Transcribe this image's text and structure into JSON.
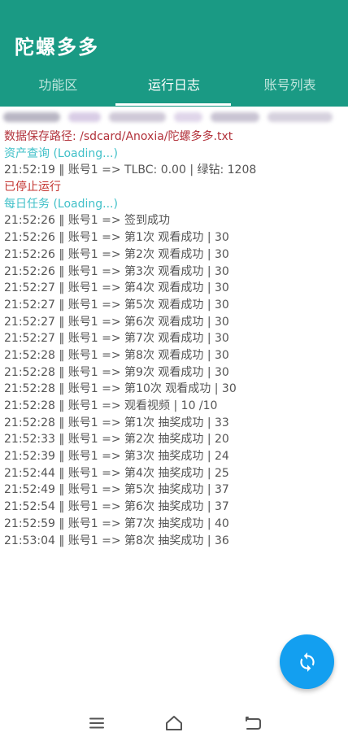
{
  "app": {
    "title": "陀螺多多",
    "colors": {
      "primary": "#1a9a84",
      "fab": "#139ff0",
      "path_text": "#b2323b",
      "section_text": "#41c0c8",
      "status_text": "#c3332f",
      "log_text": "#555555"
    }
  },
  "tabs": [
    {
      "label": "功能区",
      "active": false
    },
    {
      "label": "运行日志",
      "active": true
    },
    {
      "label": "账号列表",
      "active": false
    }
  ],
  "log": {
    "lines": [
      {
        "type": "path",
        "text": "数据保存路径: /sdcard/Anoxia/陀螺多多.txt"
      },
      {
        "type": "section",
        "text": "资产查询 (Loading...)"
      },
      {
        "type": "entry",
        "text": "21:52:19 ‖ 账号1 => TLBC: 0.00 | 绿钻: 1208"
      },
      {
        "type": "status",
        "text": "已停止运行"
      },
      {
        "type": "section",
        "text": "每日任务 (Loading...)"
      },
      {
        "type": "entry",
        "text": "21:52:26 ‖ 账号1 => 签到成功"
      },
      {
        "type": "entry",
        "text": "21:52:26 ‖ 账号1 => 第1次 观看成功 | 30"
      },
      {
        "type": "entry",
        "text": "21:52:26 ‖ 账号1 => 第2次 观看成功 | 30"
      },
      {
        "type": "entry",
        "text": "21:52:26 ‖ 账号1 => 第3次 观看成功 | 30"
      },
      {
        "type": "entry",
        "text": "21:52:27 ‖ 账号1 => 第4次 观看成功 | 30"
      },
      {
        "type": "entry",
        "text": "21:52:27 ‖ 账号1 => 第5次 观看成功 | 30"
      },
      {
        "type": "entry",
        "text": "21:52:27 ‖ 账号1 => 第6次 观看成功 | 30"
      },
      {
        "type": "entry",
        "text": "21:52:27 ‖ 账号1 => 第7次 观看成功 | 30"
      },
      {
        "type": "entry",
        "text": "21:52:28 ‖ 账号1 => 第8次 观看成功 | 30"
      },
      {
        "type": "entry",
        "text": "21:52:28 ‖ 账号1 => 第9次 观看成功 | 30"
      },
      {
        "type": "entry",
        "text": "21:52:28 ‖ 账号1 => 第10次 观看成功 | 30"
      },
      {
        "type": "entry",
        "text": "21:52:28 ‖ 账号1 => 观看视频 | 10 /10"
      },
      {
        "type": "entry",
        "text": "21:52:28 ‖ 账号1 => 第1次 抽奖成功 | 33"
      },
      {
        "type": "entry",
        "text": "21:52:33 ‖ 账号1 => 第2次 抽奖成功 | 20"
      },
      {
        "type": "entry",
        "text": "21:52:39 ‖ 账号1 => 第3次 抽奖成功 | 24"
      },
      {
        "type": "entry",
        "text": "21:52:44 ‖ 账号1 => 第4次 抽奖成功 | 25"
      },
      {
        "type": "entry",
        "text": "21:52:49 ‖ 账号1 => 第5次 抽奖成功 | 37"
      },
      {
        "type": "entry",
        "text": "21:52:54 ‖ 账号1 => 第6次 抽奖成功 | 37"
      },
      {
        "type": "entry",
        "text": "21:52:59 ‖ 账号1 => 第7次 抽奖成功 | 40"
      },
      {
        "type": "entry",
        "text": "21:53:04 ‖ 账号1 => 第8次 抽奖成功 | 36"
      }
    ]
  },
  "fab": {
    "icon": "sync-icon"
  },
  "nav": {
    "menu_icon": "menu-icon",
    "home_icon": "home-icon",
    "back_icon": "back-icon"
  }
}
